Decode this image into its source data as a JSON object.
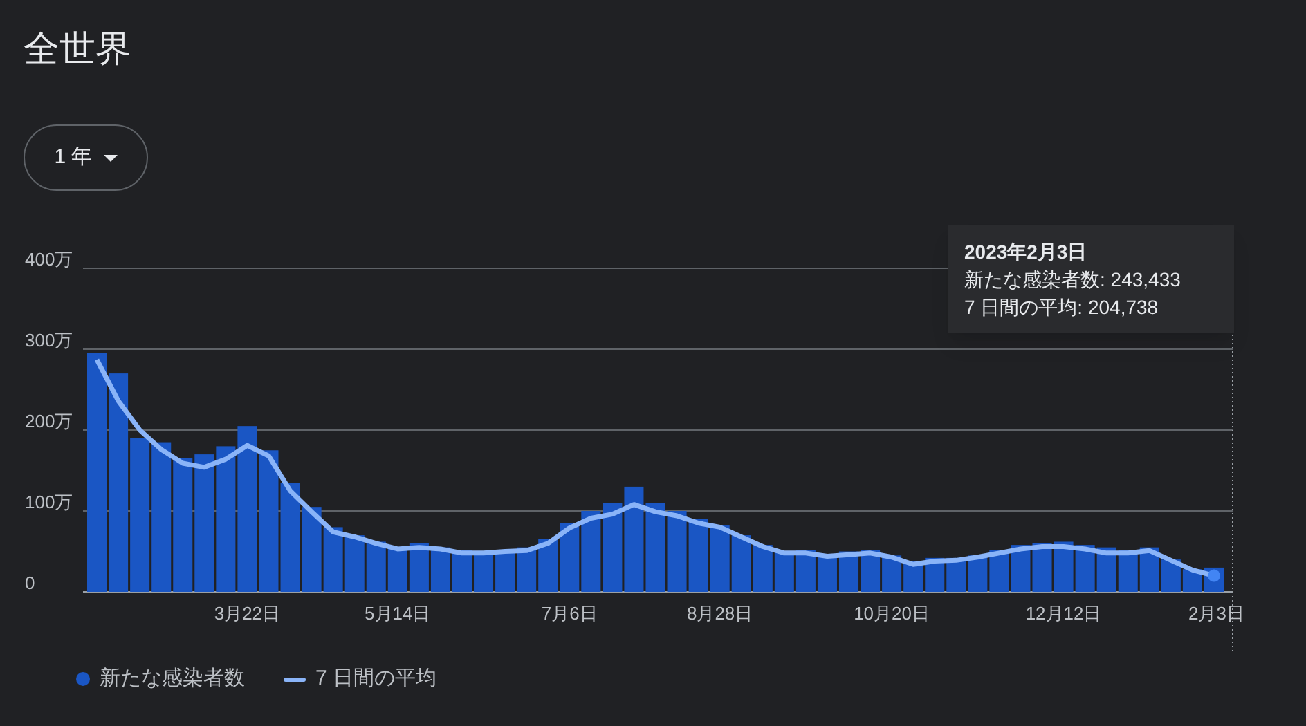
{
  "title": "全世界",
  "range_button": {
    "label": "1 年"
  },
  "chart": {
    "chart_data": {
      "type": "bar",
      "grid": true,
      "ylim": [
        0,
        400
      ],
      "categories": [
        null,
        null,
        null,
        null,
        null,
        null,
        null,
        "3月22日",
        null,
        null,
        null,
        null,
        null,
        null,
        "5月14日",
        null,
        null,
        null,
        null,
        null,
        null,
        null,
        "7月6日",
        null,
        null,
        null,
        null,
        null,
        null,
        "8月28日",
        null,
        null,
        null,
        null,
        null,
        null,
        null,
        "10月20日",
        null,
        null,
        null,
        null,
        null,
        null,
        null,
        "12月12日",
        null,
        null,
        null,
        null,
        null,
        null,
        "2月3日"
      ],
      "yticks": [
        {
          "value": 0,
          "label": "0"
        },
        {
          "value": 100,
          "label": "100万"
        },
        {
          "value": 200,
          "label": "200万"
        },
        {
          "value": 300,
          "label": "300万"
        },
        {
          "value": 400,
          "label": "400万"
        }
      ],
      "series": [
        {
          "name": "新たな感染者数",
          "color": "#1a56c4",
          "values": [
            295,
            270,
            190,
            185,
            165,
            170,
            180,
            205,
            175,
            135,
            105,
            80,
            70,
            62,
            55,
            60,
            55,
            52,
            50,
            52,
            55,
            65,
            85,
            100,
            110,
            130,
            110,
            100,
            90,
            82,
            70,
            58,
            50,
            52,
            46,
            50,
            52,
            45,
            38,
            42,
            42,
            45,
            52,
            58,
            60,
            62,
            58,
            55,
            52,
            55,
            40,
            28,
            30
          ]
        }
      ]
    }
  },
  "average": {
    "chart_data": {
      "type": "line",
      "ylim": [
        0,
        400
      ],
      "categories": [
        null,
        null,
        null,
        null,
        null,
        null,
        null,
        null,
        null,
        null,
        null,
        null,
        null,
        null,
        null,
        null,
        null,
        null,
        null,
        null,
        null,
        null,
        null,
        null,
        null,
        null,
        null,
        null,
        null,
        null,
        null,
        null,
        null,
        null,
        null,
        null,
        null,
        null,
        null,
        null,
        null,
        null,
        null,
        null,
        null,
        null,
        null,
        null,
        null,
        null,
        null,
        null,
        null
      ],
      "series": [
        {
          "name": "7 日間の平均",
          "color": "#8ab4f8",
          "values": [
            287,
            236,
            200,
            176,
            159,
            154,
            164,
            181,
            168,
            125,
            99,
            74,
            68,
            60,
            53,
            55,
            53,
            48,
            48,
            50,
            51,
            60,
            79,
            91,
            96,
            108,
            99,
            94,
            85,
            80,
            68,
            56,
            48,
            48,
            44,
            46,
            48,
            43,
            34,
            38,
            39,
            43,
            48,
            53,
            56,
            56,
            53,
            48,
            48,
            51,
            39,
            27,
            20
          ]
        }
      ]
    }
  },
  "tooltip": {
    "date": "2023年2月3日",
    "lines": [
      "新たな感染者数: 243,433",
      "7 日間の平均: 204,738"
    ]
  }
}
